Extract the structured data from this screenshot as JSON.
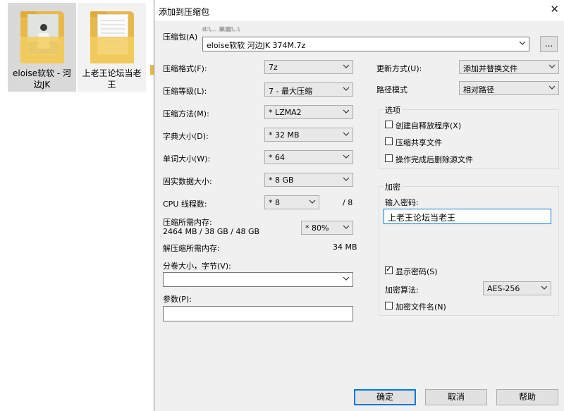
{
  "desktop": {
    "items": [
      {
        "name": "eloise软软 - 河边JK",
        "icon": "folder-icon"
      },
      {
        "name": "上老王论坛当老王",
        "icon": "folder-icon"
      }
    ]
  },
  "dialog": {
    "title": "添加到压缩包",
    "close_glyph": "✕",
    "archive_label": "压缩包(A)",
    "archive_path_partial": "d:\\... 桌面\\..\\",
    "archive_value": "eloise软软 河边JK 374M.7z",
    "browse_label": "...",
    "format_label": "压缩格式(F):",
    "format_value": "7z",
    "level_label": "压缩等级(L):",
    "level_value": "7 - 最大压缩",
    "method_label": "压缩方法(M):",
    "method_value": "* LZMA2",
    "dict_label": "字典大小(D):",
    "dict_value": "* 32 MB",
    "word_label": "单词大小(W):",
    "word_value": "* 64",
    "solid_label": "固实数据大小:",
    "solid_value": "* 8 GB",
    "threads_label": "CPU 线程数:",
    "threads_value": "* 8",
    "threads_total": "/ 8",
    "mem_compress_label": "压缩所需内存:",
    "mem_compress_detail": "2464 MB / 38 GB / 48 GB",
    "mem_percent_value": "* 80%",
    "mem_decompress_label": "解压缩所需内存:",
    "mem_decompress_value": "34 MB",
    "split_label": "分卷大小，字节(V):",
    "split_value": "",
    "params_label": "参数(P):",
    "params_value": "",
    "update_label": "更新方式(U):",
    "update_value": "添加并替换文件",
    "path_mode_label": "路径模式",
    "path_mode_value": "相对路径",
    "options_title": "选项",
    "opt_sfx": "创建自释放程序(X)",
    "opt_shared": "压缩共享文件",
    "opt_delete": "操作完成后删除源文件",
    "enc_title": "加密",
    "password_label": "输入密码:",
    "password_value": "上老王论坛当老王",
    "show_password": "显示密码(S)",
    "enc_method_label": "加密算法:",
    "enc_method_value": "AES-256",
    "enc_filenames": "加密文件名(N)",
    "check_glyph": "✓",
    "ok": "确定",
    "cancel": "取消",
    "help": "帮助"
  }
}
